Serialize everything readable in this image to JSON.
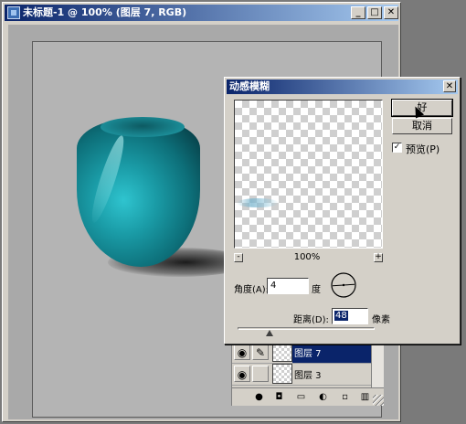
{
  "document_window": {
    "title": "未标题-1 @ 100% (图层 7, RGB)",
    "minimize_label": "_",
    "maximize_label": "□",
    "close_label": "✕"
  },
  "dialog": {
    "title": "动感模糊",
    "close_label": "✕",
    "ok_label": "好",
    "cancel_label": "取消",
    "preview_label": "预览(P)",
    "preview_checked": true,
    "zoom_out_label": "-",
    "zoom_in_label": "+",
    "zoom_level": "100%",
    "angle_label": "角度(A):",
    "angle_value": "4",
    "angle_unit": "度",
    "distance_label": "距离(D):",
    "distance_value": "48",
    "distance_unit": "像素"
  },
  "layers": {
    "items": [
      {
        "name": "图层 7",
        "selected": true
      },
      {
        "name": "图层 3",
        "selected": false
      }
    ]
  },
  "icons": {
    "eye": "eye-icon",
    "brush": "brush-icon"
  }
}
